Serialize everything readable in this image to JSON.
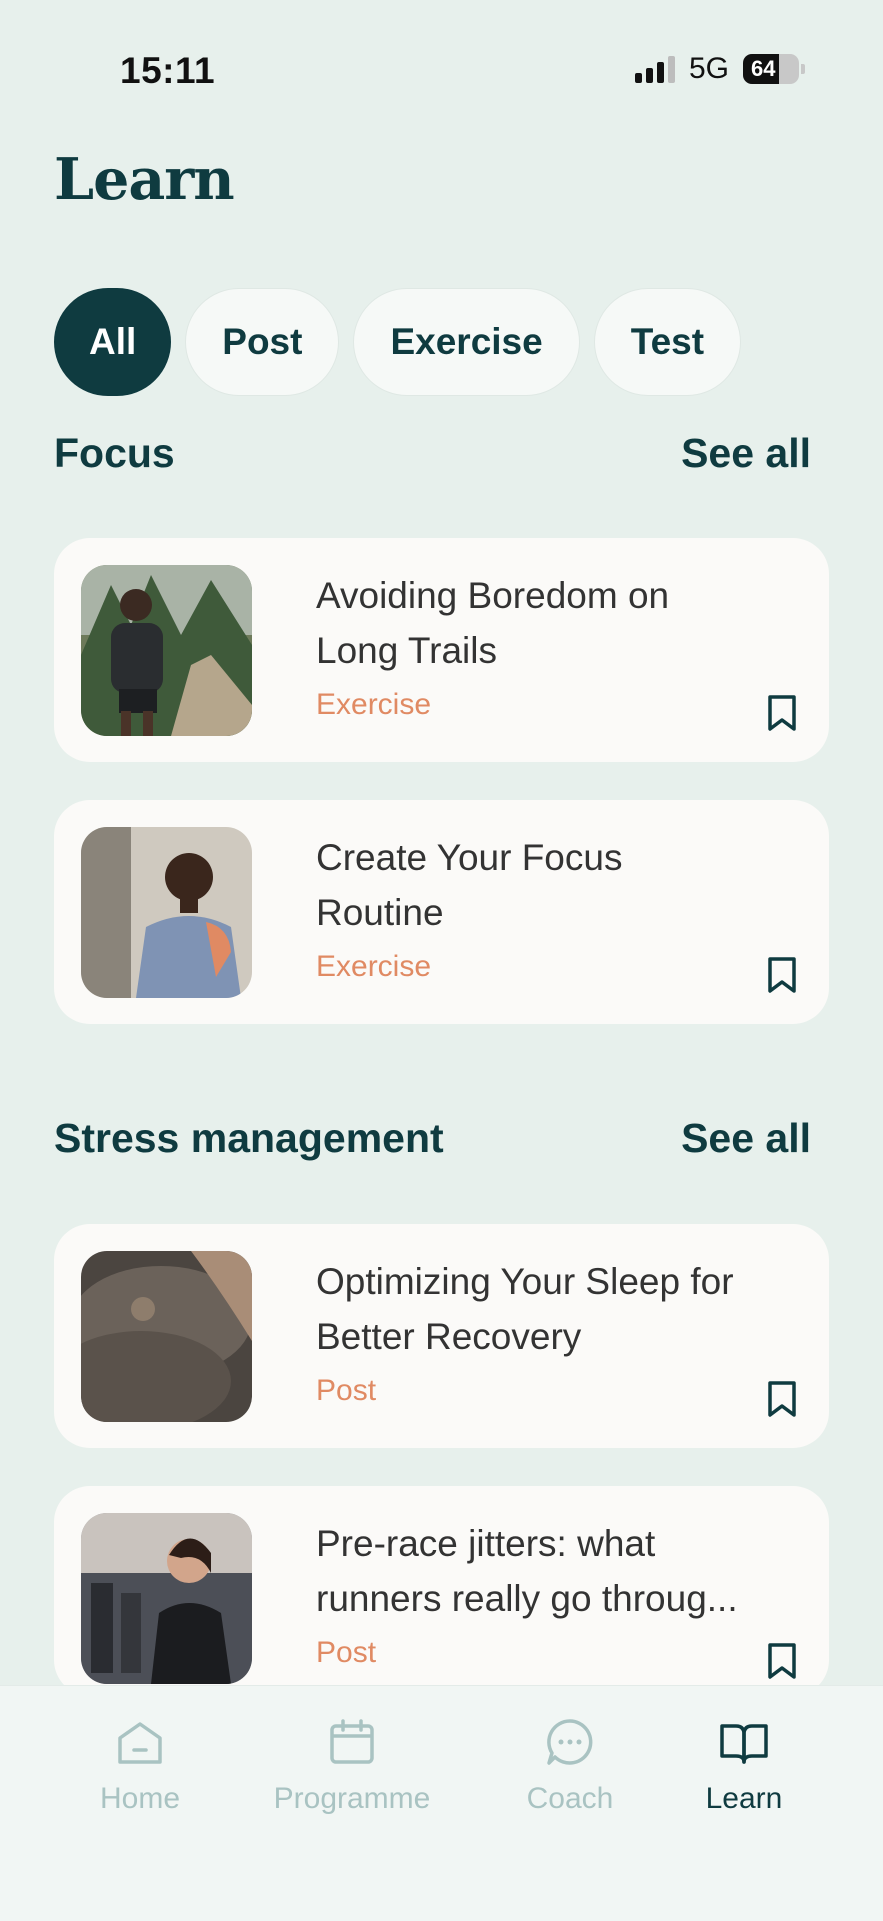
{
  "status": {
    "time": "15:11",
    "network": "5G",
    "battery": "64",
    "battery_level": 0.64
  },
  "page": {
    "title": "Learn"
  },
  "filters": [
    "All",
    "Post",
    "Exercise",
    "Test"
  ],
  "sections": [
    {
      "title": "Focus",
      "see_all": "See all",
      "items": [
        {
          "title": "Avoiding Boredom on\nLong Trails",
          "tag": "Exercise"
        },
        {
          "title": "Create Your Focus\nRoutine",
          "tag": "Exercise"
        }
      ]
    },
    {
      "title": "Stress management",
      "see_all": "See all",
      "items": [
        {
          "title": "Optimizing Your Sleep for\nBetter Recovery",
          "tag": "Post"
        },
        {
          "title": "Pre-race jitters: what\nrunners really go throug...",
          "tag": "Post"
        }
      ]
    }
  ],
  "nav": {
    "home": "Home",
    "programme": "Programme",
    "coach": "Coach",
    "learn": "Learn"
  },
  "colors": {
    "accent": "#0f3b40",
    "tag": "#e08a63",
    "background": "#e7f0ec",
    "inactive_nav": "#a9c3c2"
  }
}
